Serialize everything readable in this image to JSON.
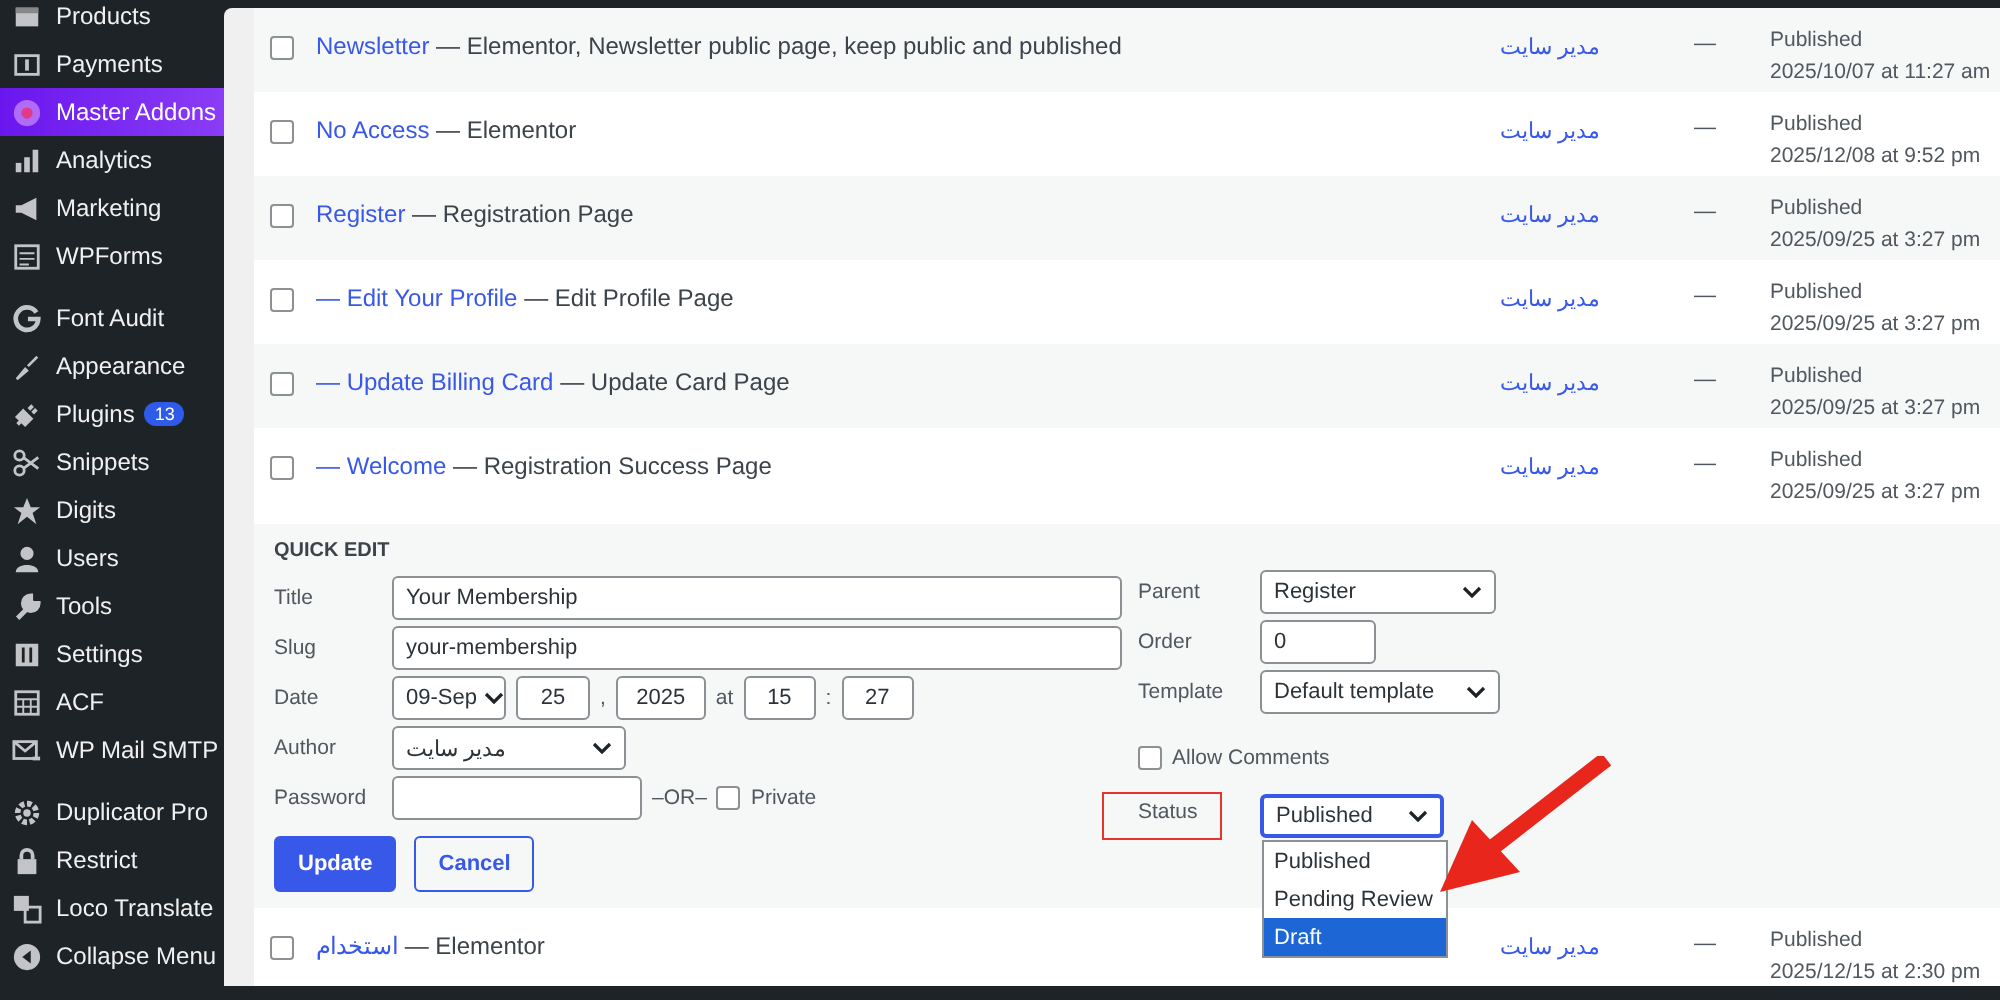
{
  "sidebar": {
    "groups": [
      [
        {
          "label": "Products",
          "selected": false
        },
        {
          "label": "Payments",
          "selected": false
        },
        {
          "label": "Master Addons",
          "selected": true
        },
        {
          "label": "Analytics",
          "selected": false
        },
        {
          "label": "Marketing",
          "selected": false
        },
        {
          "label": "WPForms",
          "selected": false
        }
      ],
      [
        {
          "label": "Font Audit",
          "selected": false
        },
        {
          "label": "Appearance",
          "selected": false
        },
        {
          "label": "Plugins",
          "selected": false,
          "badge": "13"
        },
        {
          "label": "Snippets",
          "selected": false
        },
        {
          "label": "Digits",
          "selected": false
        },
        {
          "label": "Users",
          "selected": false
        },
        {
          "label": "Tools",
          "selected": false
        },
        {
          "label": "Settings",
          "selected": false
        },
        {
          "label": "ACF",
          "selected": false
        },
        {
          "label": "WP Mail SMTP",
          "selected": false
        }
      ],
      [
        {
          "label": "Duplicator Pro",
          "selected": false
        },
        {
          "label": "Restrict",
          "selected": false
        },
        {
          "label": "Loco Translate",
          "selected": false
        },
        {
          "label": "Collapse Menu",
          "selected": false
        }
      ]
    ]
  },
  "table": {
    "rows": [
      {
        "checked": false,
        "title": "Newsletter",
        "suffix": "— Elementor, Newsletter public page, keep public and published",
        "author": "مدیر سایت",
        "comments": "—",
        "status": "Published",
        "date": "2025/10/07 at 11:27 am"
      },
      {
        "checked": false,
        "title": "No Access",
        "suffix": "— Elementor",
        "author": "مدیر سایت",
        "comments": "—",
        "status": "Published",
        "date": "2025/12/08 at 9:52 pm"
      },
      {
        "checked": false,
        "title": "Register",
        "suffix": "— Registration Page",
        "author": "مدیر سایت",
        "comments": "—",
        "status": "Published",
        "date": "2025/09/25 at 3:27 pm"
      },
      {
        "checked": false,
        "title": "— Edit Your Profile",
        "suffix": "— Edit Profile Page",
        "author": "مدیر سایت",
        "comments": "—",
        "status": "Published",
        "date": "2025/09/25 at 3:27 pm"
      },
      {
        "checked": false,
        "title": "— Update Billing Card",
        "suffix": "— Update Card Page",
        "author": "مدیر سایت",
        "comments": "—",
        "status": "Published",
        "date": "2025/09/25 at 3:27 pm"
      },
      {
        "checked": false,
        "title": "— Welcome",
        "suffix": "— Registration Success Page",
        "author": "مدیر سایت",
        "comments": "—",
        "status": "Published",
        "date": "2025/09/25 at 3:27 pm"
      }
    ],
    "after_rows": [
      {
        "checked": false,
        "title": "استخدام",
        "suffix": "— Elementor",
        "author": "مدیر سایت",
        "comments": "—",
        "status": "Published",
        "date": "2025/12/15 at 2:30 pm"
      }
    ]
  },
  "quick_edit": {
    "heading": "QUICK EDIT",
    "title": {
      "label": "Title",
      "value": "Your Membership"
    },
    "slug": {
      "label": "Slug",
      "value": "your-membership"
    },
    "date": {
      "label": "Date",
      "month": "09-Sep",
      "day": "25",
      "sep1": ",",
      "year": "2025",
      "at": "at",
      "hour": "15",
      "sep2": ":",
      "minute": "27"
    },
    "author": {
      "label": "Author",
      "value": "مدیر سایت"
    },
    "password": {
      "label": "Password",
      "or": "–OR–",
      "private_label": "Private",
      "private_checked": false
    },
    "buttons": {
      "update": "Update",
      "cancel": "Cancel"
    },
    "parent": {
      "label": "Parent",
      "value": "Register"
    },
    "order": {
      "label": "Order",
      "value": "0"
    },
    "template": {
      "label": "Template",
      "value": "Default template"
    },
    "allow_comments": {
      "label": "Allow Comments",
      "checked": false
    },
    "status": {
      "label": "Status",
      "value": "Published",
      "expanded": true,
      "options": [
        {
          "label": "Published",
          "highlighted": false
        },
        {
          "label": "Pending Review",
          "highlighted": false
        },
        {
          "label": "Draft",
          "highlighted": true
        }
      ]
    }
  }
}
